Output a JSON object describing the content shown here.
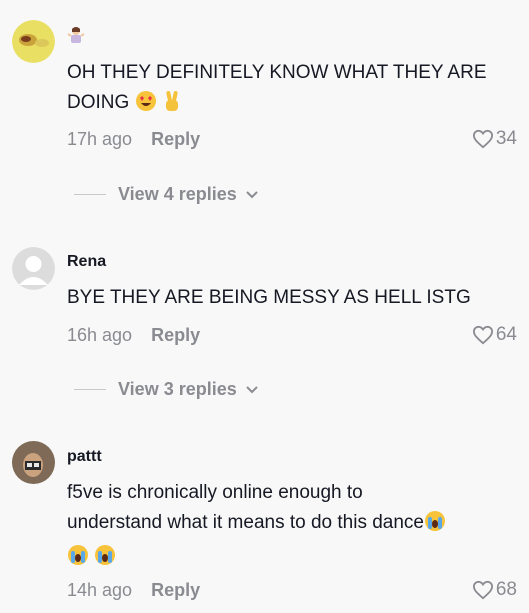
{
  "comments": [
    {
      "username": "",
      "username_emoji": "woman-shrugging-emoji",
      "text": "OH THEY DEFINITELY KNOW WHAT THEY ARE DOING",
      "text_emojis": [
        "heart-eyes-emoji",
        "victory-hand-emoji"
      ],
      "time": "17h ago",
      "reply_label": "Reply",
      "likes": "34",
      "view_replies": "View 4 replies"
    },
    {
      "username": "Rena",
      "text": "BYE THEY ARE BEING MESSY AS HELL ISTG",
      "time": "16h ago",
      "reply_label": "Reply",
      "likes": "64",
      "view_replies": "View 3 replies"
    },
    {
      "username": "pattt",
      "text_line1": "f5ve is chronically online enough to",
      "text_line2": "understand what it means to do this dance",
      "text_emojis": [
        "crying-emoji",
        "crying-emoji",
        "crying-emoji"
      ],
      "time": "14h ago",
      "reply_label": "Reply",
      "likes": "68"
    }
  ],
  "icons": {
    "like": "heart-outline-icon",
    "expand": "chevron-down-icon"
  },
  "colors": {
    "background": "#f8f8f8",
    "text": "#161823",
    "muted": "#8a8b91"
  }
}
